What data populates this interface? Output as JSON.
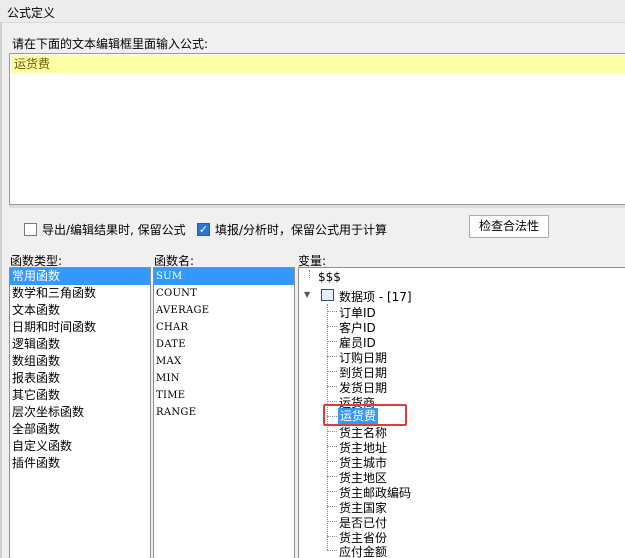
{
  "window": {
    "title": "公式定义"
  },
  "editor": {
    "prompt": "请在下面的文本编辑框里面输入公式:",
    "formula": "运货费"
  },
  "options": {
    "keep_on_export": {
      "label": "导出/编辑结果时, 保留公式",
      "checked": false
    },
    "keep_on_fill": {
      "label": "填报/分析时，保留公式用于计算",
      "checked": true
    },
    "check_button": "检查合法性"
  },
  "function_types": {
    "label": "函数类型:",
    "items": [
      "常用函数",
      "数学和三角函数",
      "文本函数",
      "日期和时间函数",
      "逻辑函数",
      "数组函数",
      "报表函数",
      "其它函数",
      "层次坐标函数",
      "全部函数",
      "自定义函数",
      "插件函数"
    ],
    "selected": "常用函数"
  },
  "function_names": {
    "label": "函数名:",
    "items": [
      "SUM",
      "COUNT",
      "AVERAGE",
      "CHAR",
      "DATE",
      "MAX",
      "MIN",
      "TIME",
      "RANGE"
    ],
    "selected": "SUM"
  },
  "variables": {
    "label": "变量:",
    "root": "$$$",
    "group": "数据项 - [17]",
    "items": [
      "订单ID",
      "客户ID",
      "雇员ID",
      "订购日期",
      "到货日期",
      "发货日期",
      "运货商",
      "运货费",
      "货主名称",
      "货主地址",
      "货主城市",
      "货主地区",
      "货主邮政编码",
      "货主国家",
      "是否已付",
      "货主省份",
      "应付金额"
    ],
    "selected": "运货费"
  },
  "colors": {
    "selection": "#3399ff",
    "formula_highlight": "#ffffa6",
    "annotation": "#e33b3b"
  }
}
